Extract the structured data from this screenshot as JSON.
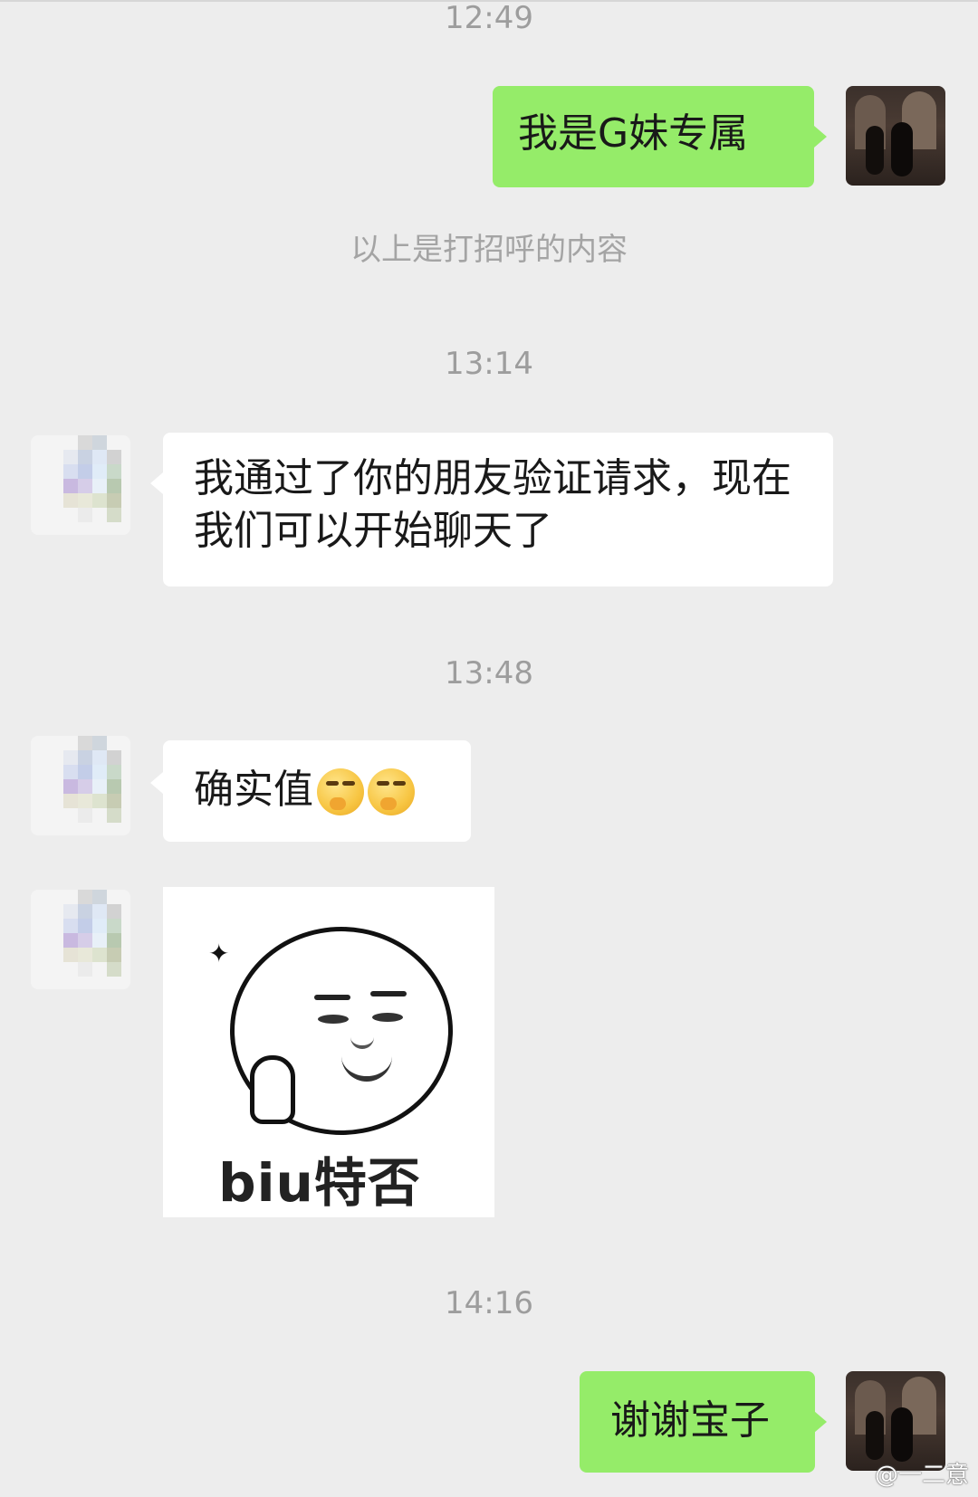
{
  "messages": {
    "time_1": "12:49",
    "greeting_text": "我是G妹专属",
    "system_note": "以上是打招呼的内容",
    "time_2": "13:14",
    "friend_accept_text": "我通过了你的朋友验证请求，现在我们可以开始聊天了",
    "time_3": "13:48",
    "reply_text": "确实值",
    "sticker_caption": "biu特否",
    "time_4": "14:16",
    "thanks_text": "谢谢宝子"
  },
  "icons": {
    "emoji": "smirk-thinking-emoji",
    "sticker": "thumbs-up-meme-sticker"
  },
  "colors": {
    "background": "#ededed",
    "my_bubble": "#95ec69",
    "their_bubble": "#ffffff",
    "timestamp": "#9d9d9d"
  },
  "watermark": {
    "text": "@一二意"
  }
}
